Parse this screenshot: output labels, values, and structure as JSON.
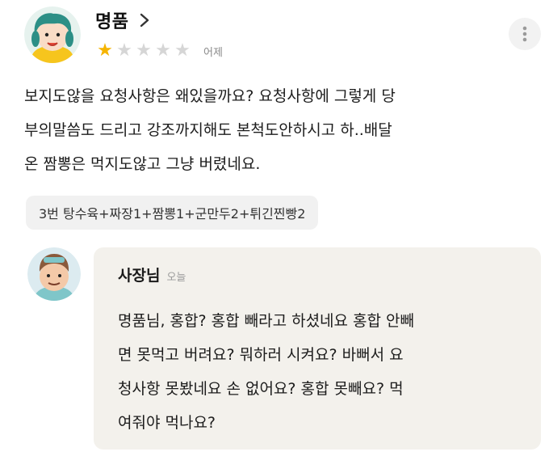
{
  "review": {
    "reviewer_name": "명품",
    "avatar_icon": "green-haired-character-avatar",
    "rating": 1,
    "rating_max": 5,
    "star_filled_color": "#f5b400",
    "star_empty_color": "#d6d6d6",
    "date": "어제",
    "more_icon": "more-vertical-icon",
    "body_lines": [
      "보지도않을 요청사항은 왜있을까요? 요청사항에 그렇게 당",
      "부의말씀도 드리고 강조까지해도 본척도안하시고 하..배달",
      "온 짬뽕은 먹지도않고 그냥 버렸네요."
    ],
    "order_items": "3번 탕수육+짜장1+짬뽕1+군만두2+튀긴찐빵2"
  },
  "owner_reply": {
    "name": "사장님",
    "date": "오늘",
    "avatar_icon": "chef-character-avatar",
    "background_color": "#f3f1ec",
    "body_lines": [
      "명품님, 홍합? 홍합 빼라고 하셨네요 홍합 안빼",
      "면 못먹고 버려요? 뭐하러 시켜요? 바뻐서 요",
      "청사항 못봤네요 손 없어요? 홍합 못빼요? 먹",
      "여줘야 먹나요?"
    ]
  }
}
